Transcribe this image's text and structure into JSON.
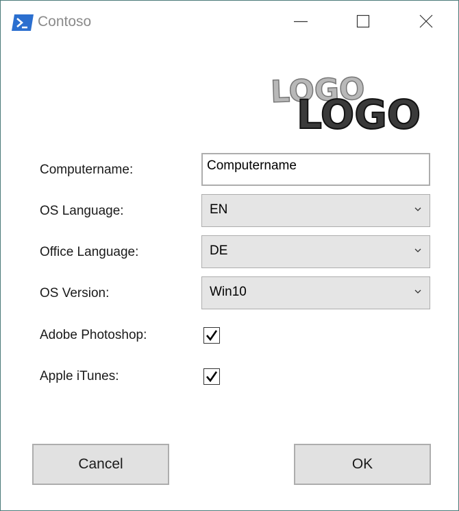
{
  "window": {
    "title": "Contoso",
    "controls": [
      "minimize-icon",
      "maximize-icon",
      "close-icon"
    ]
  },
  "logo": {
    "text_back": "LOGO",
    "text_front": "LOGO"
  },
  "form": {
    "computername_label": "Computername:",
    "computername_value": "Computername",
    "os_language_label": "OS Language:",
    "os_language_value": "EN",
    "office_language_label": "Office Language:",
    "office_language_value": "DE",
    "os_version_label": "OS Version:",
    "os_version_value": "Win10",
    "photoshop_label": "Adobe Photoshop:",
    "photoshop_checked": true,
    "itunes_label": "Apple iTunes:",
    "itunes_checked": true
  },
  "buttons": {
    "cancel_label": "Cancel",
    "ok_label": "OK"
  },
  "colors": {
    "accent": "#2b6fcf",
    "border": "#4a7a78",
    "control_bg": "#e5e5e5"
  }
}
